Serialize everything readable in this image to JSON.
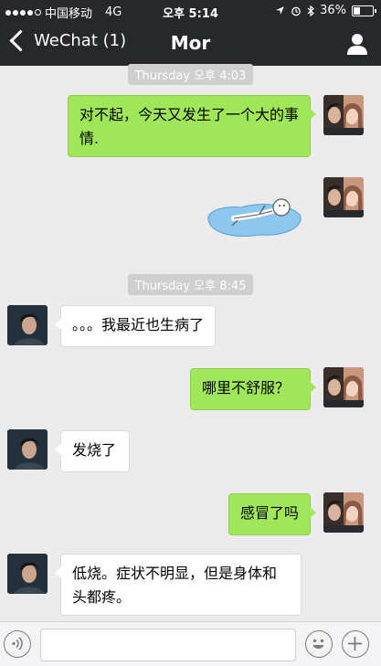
{
  "status_bar": {
    "carrier": "中国移动",
    "network": "4G",
    "time": "오후 5:14",
    "battery": "36%",
    "battery_level": 0.36
  },
  "nav": {
    "back_label": "WeChat (1)",
    "title": "Mor"
  },
  "timestamps": [
    "Thursday 오후 4:03",
    "Thursday 오후 8:45"
  ],
  "messages": [
    {
      "side": "sent",
      "text": "对不起，今天又发生了一个大的事情."
    },
    {
      "side": "sent",
      "kind": "sticker",
      "icon": "lying-down-sticker"
    },
    {
      "side": "received",
      "text": "。。。我最近也生病了"
    },
    {
      "side": "sent",
      "text": "哪里不舒服？"
    },
    {
      "side": "received",
      "text": "发烧了"
    },
    {
      "side": "sent",
      "text": "感冒了吗"
    },
    {
      "side": "received",
      "text": "低烧。症状不明显，但是身体和头都疼。"
    }
  ],
  "input_bar": {
    "placeholder": "",
    "icons": [
      "voice-icon",
      "emoji-icon",
      "plus-icon"
    ]
  },
  "colors": {
    "bar_bg": "#26282b",
    "chat_bg": "#ebebeb",
    "sent_bubble": "#9fe658",
    "recv_bubble": "#ffffff",
    "timestamp_bg": "#cfcfcf"
  }
}
